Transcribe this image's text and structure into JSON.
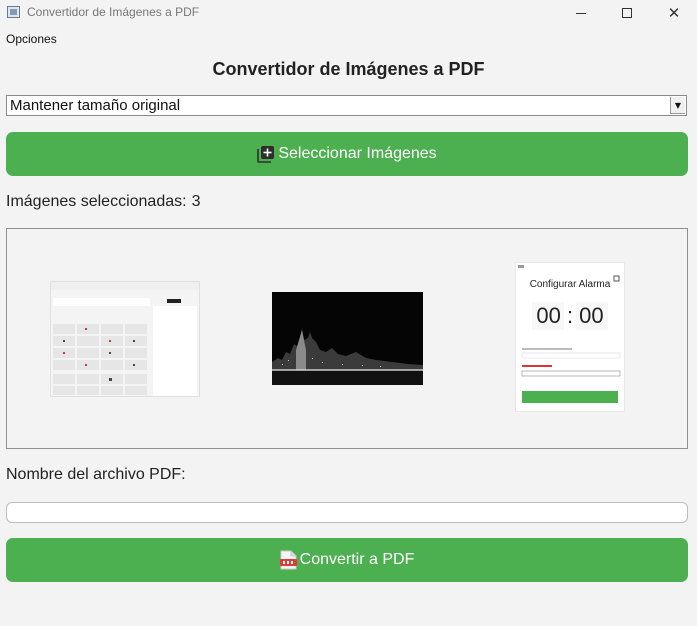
{
  "window": {
    "title": "Convertidor de Imágenes a PDF"
  },
  "menu": {
    "items": [
      "Opciones"
    ]
  },
  "app": {
    "title": "Convertidor de Imágenes a PDF"
  },
  "size_select": {
    "value": "Mantener tamaño original"
  },
  "select_button": {
    "label": "Seleccionar Imágenes",
    "icon": "add-image-icon"
  },
  "selected_count": {
    "label": "Imágenes seleccionadas:",
    "value": "3"
  },
  "thumbnails": [
    {
      "name": "calculator-screenshot-thumbnail"
    },
    {
      "name": "city-night-photo-thumbnail"
    },
    {
      "name": "alarm-app-screenshot-thumbnail",
      "title": "Configurar Alarma",
      "time": "00 : 00"
    }
  ],
  "pdf_name": {
    "label": "Nombre del archivo PDF:",
    "value": ""
  },
  "convert_button": {
    "label": "Convertir a PDF",
    "icon": "pdf-file-icon"
  },
  "colors": {
    "accent": "#4caf50",
    "background": "#f3f3f3"
  }
}
